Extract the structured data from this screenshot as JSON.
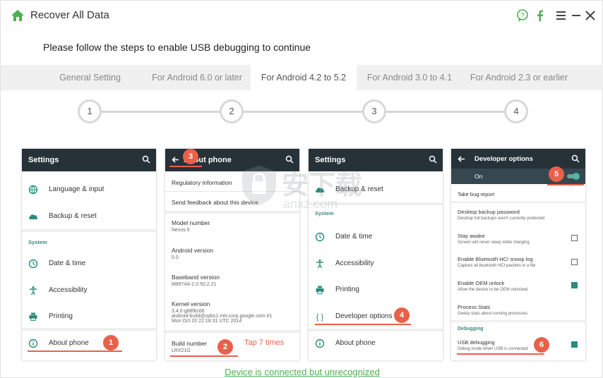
{
  "app": {
    "title": "Recover All Data"
  },
  "prompt": "Please follow the steps to enable USB debugging to continue",
  "tabs": [
    {
      "label": "General Setting"
    },
    {
      "label": "For Android 6.0 or later"
    },
    {
      "label": "For Android 4.2 to 5.2"
    },
    {
      "label": "For Android 3.0 to 4.1"
    },
    {
      "label": "For Android 2.3 or earlier"
    }
  ],
  "steps": [
    "1",
    "2",
    "3",
    "4"
  ],
  "phone1": {
    "title": "Settings",
    "items": [
      "Language & input",
      "Backup & reset",
      "Date & time",
      "Accessibility",
      "Printing",
      "About phone"
    ],
    "section": "System"
  },
  "phone2": {
    "title": "About phone",
    "rows": [
      {
        "title": "Regulatory information"
      },
      {
        "title": "Send feedback about this device"
      },
      {
        "title": "Model number",
        "value": "Nexus 5"
      },
      {
        "title": "Android version",
        "value": "5.0"
      },
      {
        "title": "Baseband version",
        "value": "M8974A-2.0.50.2.21"
      },
      {
        "title": "Kernel version",
        "value": "3.4.0-g88fbc66",
        "value2": "android-build@vpbs1.mtv.corp.google.com #1",
        "value3": "Mon Oct 20 22:18:31 UTC 2014"
      },
      {
        "title": "Build number",
        "value": "LRX21O"
      }
    ],
    "tap_note": "Tap 7 times"
  },
  "phone3": {
    "title": "Settings",
    "section": "System",
    "items": [
      "Backup & reset",
      "Date & time",
      "Accessibility",
      "Printing",
      "Developer options",
      "About phone"
    ]
  },
  "phone4": {
    "title": "Developer options",
    "on_label": "On",
    "rows": [
      {
        "title": "Take bug report"
      },
      {
        "title": "Desktop backup password",
        "sub": "Desktop full backups aren't currently protected"
      },
      {
        "title": "Stay awake",
        "sub": "Screen will never sleep while charging"
      },
      {
        "title": "Enable Bluetooth HCI snoop log",
        "sub": "Capture all bluetooth HCI packets in a file"
      },
      {
        "title": "Enable OEM unlock",
        "sub": "Allow the device to be OEM unlocked"
      },
      {
        "title": "Process Stats",
        "sub": "Geeky stats about running processes"
      },
      {
        "title": "USB debugging",
        "sub": "Debug mode when USB is connected"
      }
    ],
    "section": "Debugging"
  },
  "badges": [
    "1",
    "2",
    "3",
    "4",
    "5",
    "6"
  ],
  "watermark": {
    "text": "安下载",
    "sub": "anxz.com"
  },
  "status": "Device is connected but unrecognized",
  "colors": {
    "accent": "#e8614a",
    "green": "#4cb050",
    "bar": "#263238",
    "teal": "#2a8c7a"
  }
}
